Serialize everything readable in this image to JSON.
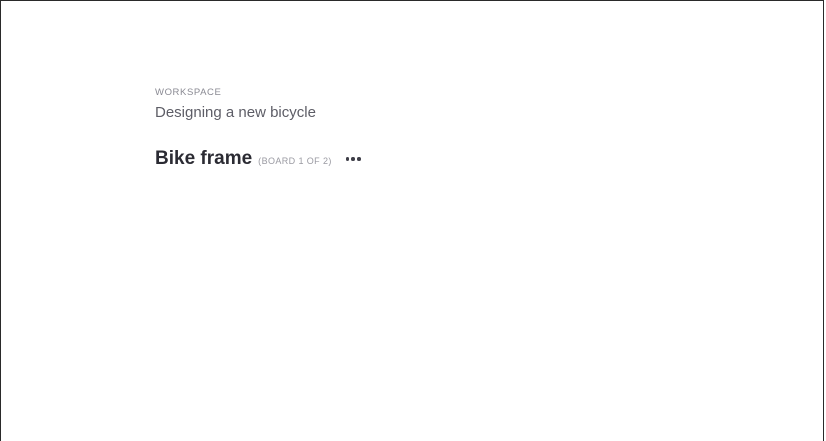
{
  "workspace": {
    "label": "WORKSPACE",
    "name": "Designing a new bicycle"
  },
  "board": {
    "title": "Bike frame",
    "count": "(BOARD 1 OF 2)",
    "menu_icon": "more-horizontal-icon"
  }
}
